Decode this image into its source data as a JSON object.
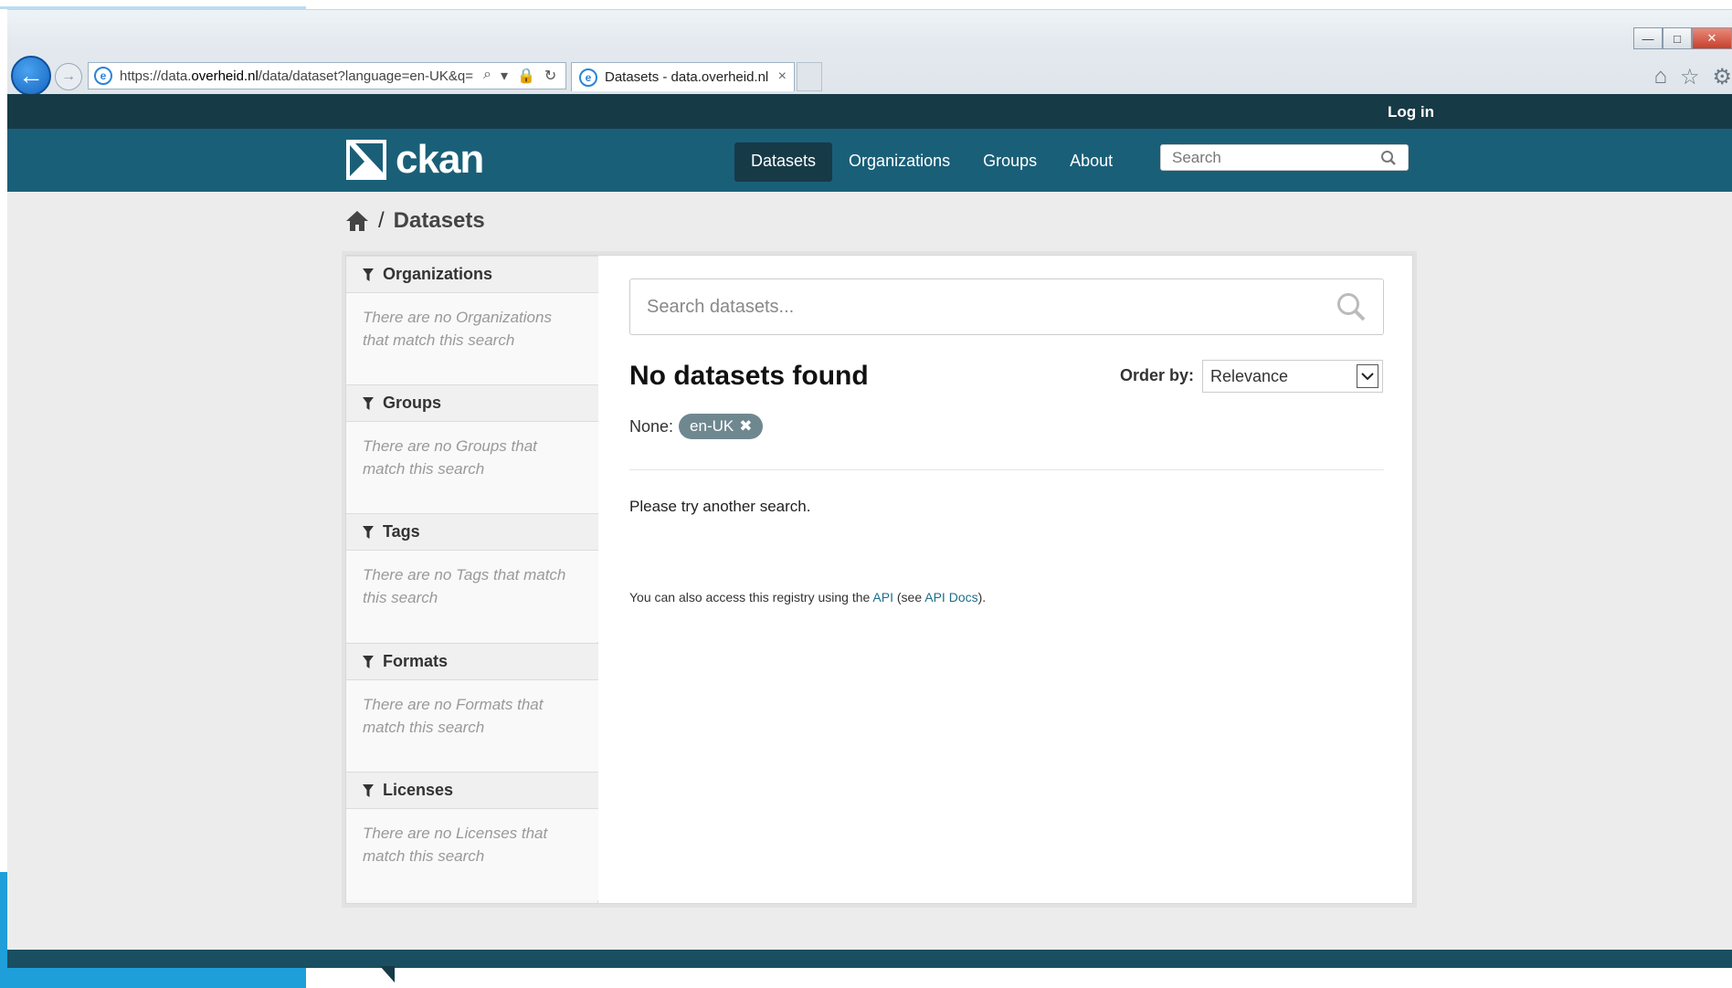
{
  "browser": {
    "url_prefix": "https://data.",
    "url_domain": "overheid.nl",
    "url_rest": "/data/dataset?language=en-UK&q=",
    "tab_title": "Datasets - data.overheid.nl",
    "tab_close": "×",
    "ie_glyph": "e",
    "back_glyph": "←",
    "forward_glyph": "→",
    "search_glyph": "⌕",
    "dropdown_glyph": "▾",
    "lock_glyph": "🔒",
    "refresh_glyph": "↻",
    "home_glyph": "⌂",
    "favorites_glyph": "☆",
    "tools_glyph": "⚙",
    "min_glyph": "—",
    "max_glyph": "□",
    "close_glyph": "✕"
  },
  "account": {
    "login": "Log in"
  },
  "header": {
    "logo_text": "ckan",
    "nav": [
      "Datasets",
      "Organizations",
      "Groups",
      "About"
    ],
    "search_placeholder": "Search"
  },
  "breadcrumb": {
    "separator": "/",
    "current": "Datasets"
  },
  "facets": [
    {
      "title": "Organizations",
      "empty": "There are no Organizations that match this search"
    },
    {
      "title": "Groups",
      "empty": "There are no Groups that match this search"
    },
    {
      "title": "Tags",
      "empty": "There are no Tags that match this search"
    },
    {
      "title": "Formats",
      "empty": "There are no Formats that match this search"
    },
    {
      "title": "Licenses",
      "empty": "There are no Licenses that match this search"
    }
  ],
  "main": {
    "search_placeholder": "Search datasets...",
    "results_title": "No datasets found",
    "order_label": "Order by:",
    "order_value": "Relevance",
    "filter_label": "None:",
    "filter_pill": "en-UK",
    "pill_remove": "✖",
    "try_msg": "Please try another search.",
    "api_prefix": "You can also access this registry using the ",
    "api_link": "API",
    "api_mid": " (see ",
    "api_docs_link": "API Docs",
    "api_suffix": ")."
  },
  "colors": {
    "account_bar": "#173a47",
    "masthead": "#1a5f78",
    "pill": "#6f8890",
    "link": "#1f6d8a"
  }
}
